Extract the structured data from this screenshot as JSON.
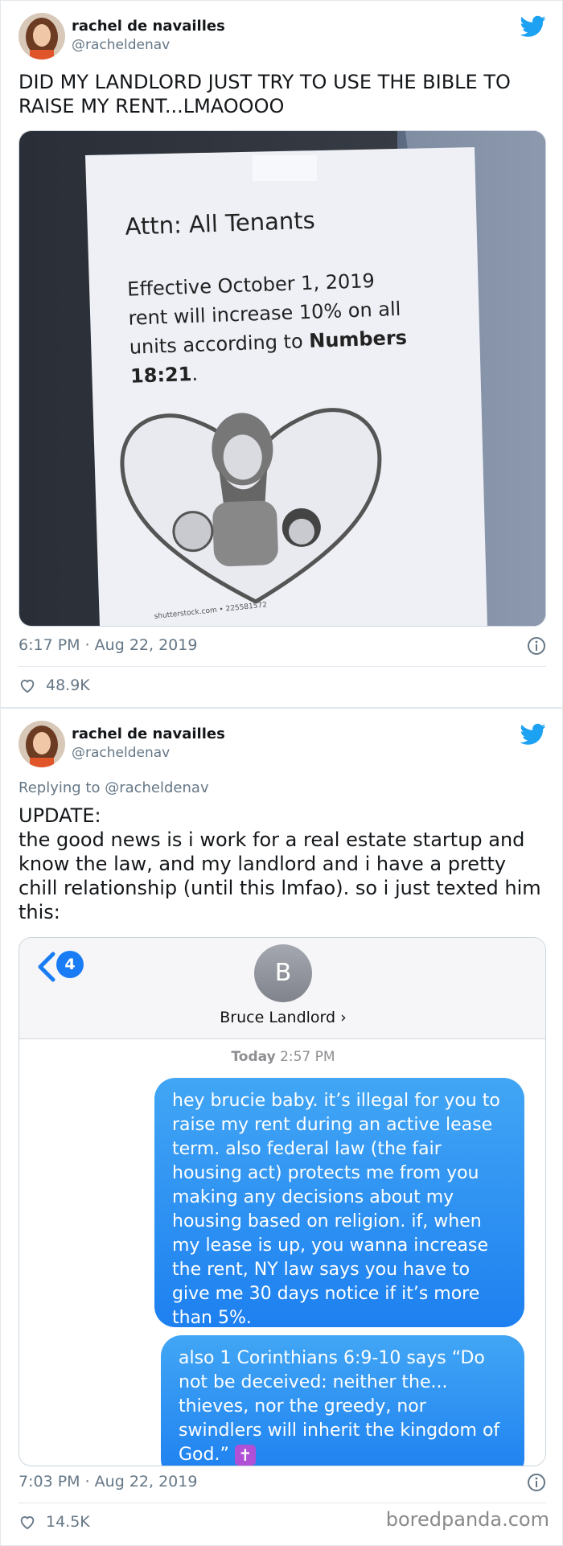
{
  "tweets": [
    {
      "author_name": "rachel de navailles",
      "author_handle": "@racheldenav",
      "text": "DID MY LANDLORD JUST TRY TO USE THE BIBLE TO RAISE MY RENT...LMAOOOO",
      "photo": {
        "sign_title": "Attn: All Tenants",
        "sign_body_lines": [
          "Effective October 1, 2019",
          "rent will increase 10% on all",
          "units according to "
        ],
        "sign_bold_ref_1": "Numbers",
        "sign_bold_ref_2": "18:21",
        "sign_period": ".",
        "stock_credit": "shutterstock.com • 225581572"
      },
      "timestamp": "6:17 PM · Aug 22, 2019",
      "likes": "48.9K"
    },
    {
      "author_name": "rachel de navailles",
      "author_handle": "@racheldenav",
      "replying_to": "Replying to @racheldenav",
      "text_line1": "UPDATE:",
      "text_body": "the good news is i work for a real estate startup and know the law, and my landlord and i have a pretty chill relationship (until this lmfao). so i just texted him this:",
      "imessage": {
        "back_count": "4",
        "contact_initial": "B",
        "contact_name": "Bruce Landlord ›",
        "time_day": "Today",
        "time_clock": "2:57 PM",
        "bubble_1": "hey brucie baby. it’s illegal for you to raise my rent during an active lease term. also federal law (the fair housing act) protects me from you making any decisions about my housing based on religion. if, when my lease is up, you wanna increase the rent, NY law says you have to give me 30 days notice if it’s more than 5%.",
        "bubble_2": "also 1 Corinthians 6:9-10 says “Do not be deceived: neither the... thieves, nor the greedy, nor swindlers will inherit the kingdom of God.”",
        "bubble_2_emoji": "✝"
      },
      "timestamp": "7:03 PM · Aug 22, 2019",
      "likes": "14.5K"
    }
  ],
  "watermark": "boredpanda.com",
  "colors": {
    "twitter_blue": "#1da1f2",
    "imessage_blue": "#1d80f0",
    "meta_gray": "#657786"
  }
}
